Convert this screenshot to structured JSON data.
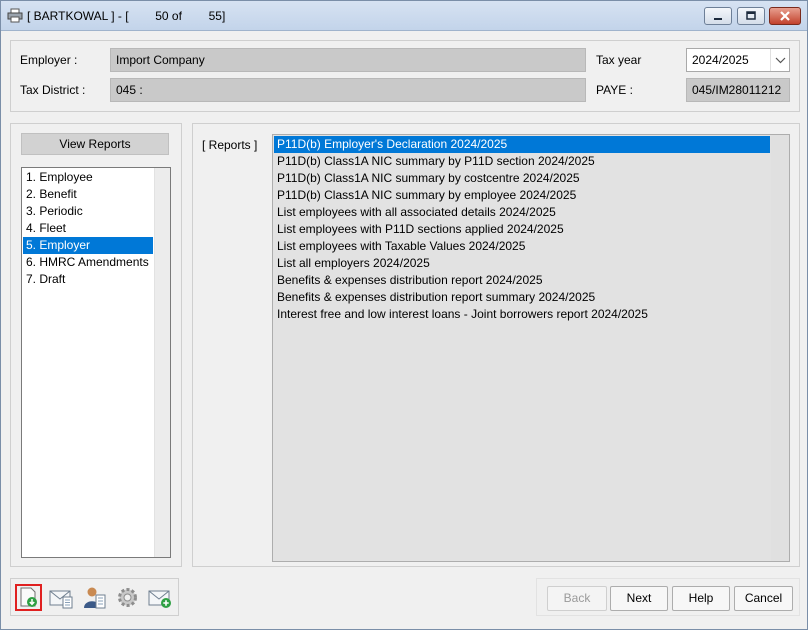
{
  "window": {
    "title": "[ BARTKOWAL ] - [        50 of        55]"
  },
  "header": {
    "employer_label": "Employer :",
    "employer_value": "Import Company",
    "tax_district_label": "Tax District :",
    "tax_district_value": "045 :",
    "tax_year_label": "Tax year",
    "tax_year_value": "2024/2025",
    "paye_label": "PAYE :",
    "paye_value": "045/IM28011212"
  },
  "sidebar": {
    "heading": "View Reports",
    "items": [
      {
        "label": "1. Employee",
        "selected": false
      },
      {
        "label": "2. Benefit",
        "selected": false
      },
      {
        "label": "3. Periodic",
        "selected": false
      },
      {
        "label": "4. Fleet",
        "selected": false
      },
      {
        "label": "5. Employer",
        "selected": true
      },
      {
        "label": "6. HMRC Amendments",
        "selected": false
      },
      {
        "label": "7. Draft",
        "selected": false
      }
    ]
  },
  "reports": {
    "label": "[ Reports ]",
    "items": [
      {
        "label": "P11D(b) Employer's Declaration 2024/2025",
        "selected": true
      },
      {
        "label": "P11D(b) Class1A NIC summary by P11D section 2024/2025",
        "selected": false
      },
      {
        "label": "P11D(b) Class1A NIC summary by costcentre 2024/2025",
        "selected": false
      },
      {
        "label": "P11D(b) Class1A NIC summary by employee 2024/2025",
        "selected": false
      },
      {
        "label": "List employees with all associated details 2024/2025",
        "selected": false
      },
      {
        "label": "List employees with P11D sections applied 2024/2025",
        "selected": false
      },
      {
        "label": "List employees with Taxable Values 2024/2025",
        "selected": false
      },
      {
        "label": "List all employers 2024/2025",
        "selected": false
      },
      {
        "label": "Benefits & expenses distribution report 2024/2025",
        "selected": false
      },
      {
        "label": "Benefits & expenses distribution report summary 2024/2025",
        "selected": false
      },
      {
        "label": "Interest free and low interest loans - Joint borrowers report 2024/2025",
        "selected": false
      }
    ]
  },
  "toolbar": {
    "icons": [
      "export-document-icon",
      "email-report-icon",
      "employee-card-icon",
      "settings-gear-icon",
      "add-email-icon"
    ]
  },
  "buttons": {
    "back": "Back",
    "next": "Next",
    "help": "Help",
    "cancel": "Cancel"
  },
  "colors": {
    "selection": "#0078d7",
    "active_tool_border": "#e02020"
  }
}
